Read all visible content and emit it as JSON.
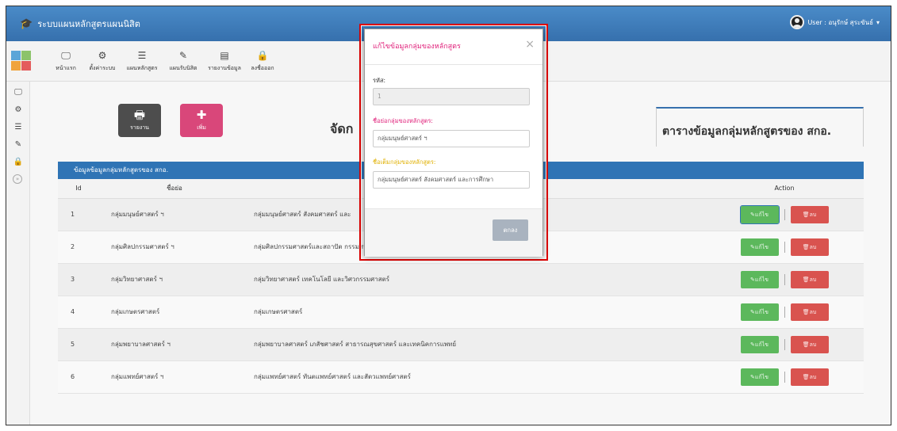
{
  "navbar": {
    "brand": "ระบบแผนหลักสูตรแผนนิสิต",
    "user_label": "User : อนุรักษ์ สุระขันธ์"
  },
  "toolbar": {
    "items": [
      {
        "label": "หน้าแรก",
        "icon": "monitor-icon"
      },
      {
        "label": "ตั้งค่าระบบ",
        "icon": "gears-icon"
      },
      {
        "label": "แผนหลักสูตร",
        "icon": "list-icon"
      },
      {
        "label": "แผนรับนิสิต",
        "icon": "edit-icon"
      },
      {
        "label": "รายงานข้อมูล",
        "icon": "report-icon"
      },
      {
        "label": "ลงชื่อออก",
        "icon": "lock-icon"
      }
    ]
  },
  "actions": {
    "report_label": "รายงาน",
    "add_label": "เพิ่ม"
  },
  "page": {
    "heading": "จัดก",
    "side_title": "ตารางข้อมูลกลุ่มหลักสูตรของ สกอ."
  },
  "table": {
    "panel_title": "ข้อมูลข้อมูลกลุ่มหลักสูตรของ สกอ.",
    "headers": {
      "id": "Id",
      "short": "ชื่อย่อ",
      "full": "",
      "action": "Action"
    },
    "rows": [
      {
        "id": "1",
        "short": "กลุ่มมนุษย์ศาสตร์ ฯ",
        "full": "กลุ่มมนุษย์ศาสตร์ สังคมศาสตร์ และ"
      },
      {
        "id": "2",
        "short": "กลุ่มศิลปกรรมศาสตร์ ฯ",
        "full": "กลุ่มศิลปกรรมศาสตร์และสถาปัต กรรมศาสตร์"
      },
      {
        "id": "3",
        "short": "กลุ่มวิทยาศาสตร์ ฯ",
        "full": "กลุ่มวิทยาศาสตร์ เทคโนโลยี และวิศวกรรมศาสตร์"
      },
      {
        "id": "4",
        "short": "กลุ่มเกษตรศาสตร์",
        "full": "กลุ่มเกษตรศาสตร์"
      },
      {
        "id": "5",
        "short": "กลุ่มพยาบาลศาสตร์ ฯ",
        "full": "กลุ่มพยาบาลศาสตร์ เภสัชศาสตร์ สาธารณสุขศาสตร์ และเทคนิคการแพทย์"
      },
      {
        "id": "6",
        "short": "กลุ่มแพทย์ศาสตร์ ฯ",
        "full": "กลุ่มแพทย์ศาสตร์ ทันตแพทย์ศาสตร์ และสัตวแพทย์ศาสตร์"
      }
    ],
    "edit_label": "แก้ไข",
    "delete_label": "ลบ"
  },
  "modal": {
    "title": "แก้ไขข้อมูลกลุ่มของหลักสูตร",
    "code_label": "รหัส:",
    "code_value": "1",
    "short_label": "ชื่อย่อกลุ่มของหลักสูตร:",
    "short_value": "กลุ่มมนุษย์ศาสตร์ ฯ",
    "full_label": "ชื่อเต็มกลุ่มของหลักสูตร:",
    "full_value": "กลุ่มมนุษย์ศาสตร์ สังคมศาสตร์ และการศึกษา",
    "ok_label": "ตกลง"
  },
  "colors": {
    "navbar": "#3f7fbf",
    "panel_header": "#2f74b5",
    "edit_button": "#5cb85c",
    "delete_button": "#d9534f",
    "report_button": "#4d4d4d",
    "add_button": "#d9477a",
    "modal_title": "#e0207a",
    "short_label": "#e0207a",
    "full_label": "#e0b000",
    "highlight": "#e00000"
  }
}
